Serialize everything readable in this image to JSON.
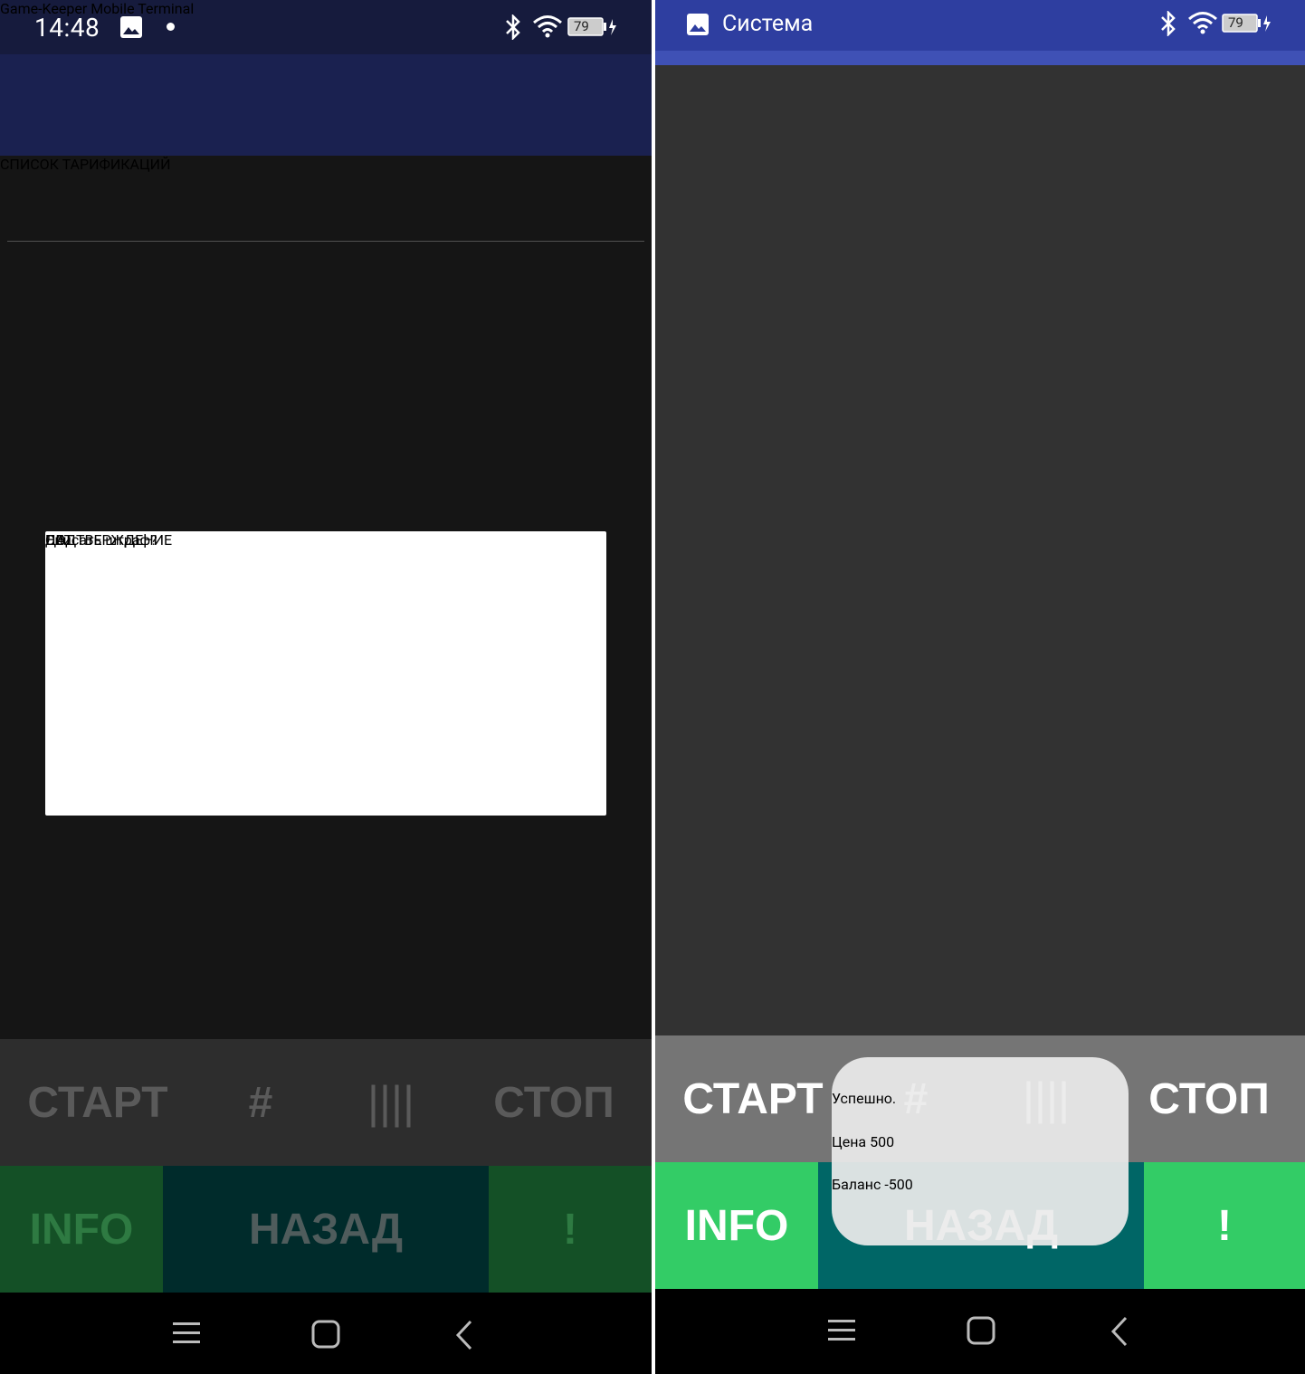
{
  "left_screen": {
    "status": {
      "time": "14:48",
      "battery": "79"
    },
    "app_title": "Game-Keeper Mobile Terminal",
    "subheader": "СПИСОК ТАРИФИКАЦИЙ",
    "dialog": {
      "title": "ПОДТВЕРЖДЕНИЕ",
      "message": "Списать штраф?",
      "no_label": "НЕТ",
      "yes_label": "ДА"
    },
    "toolbar": {
      "start": "СТАРТ",
      "hash": "#",
      "barcode": "||||",
      "stop": "СТОП"
    },
    "bottom": {
      "info": "INFO",
      "back": "НАЗАД",
      "alert": "!"
    }
  },
  "right_screen": {
    "status": {
      "notification_title": "Система",
      "battery": "79"
    },
    "toolbar": {
      "start": "СТАРТ",
      "hash": "#",
      "barcode": "||||",
      "stop": "СТОП"
    },
    "bottom": {
      "info": "INFO",
      "back": "НАЗАД",
      "alert": "!"
    },
    "toast": {
      "line1": "Успешно.",
      "line2": "Цена  500",
      "line3": "Баланс  -500"
    }
  },
  "colors": {
    "left_status_bg": "#161b3d",
    "left_appbar_bg": "#1a2150",
    "right_status_bg": "#2e3ea0",
    "green": "#33cc66",
    "teal": "#006666"
  },
  "icons": [
    "image-icon",
    "bluetooth-icon",
    "wifi-icon",
    "battery-icon",
    "menu-icon",
    "home-icon",
    "back-icon"
  ]
}
